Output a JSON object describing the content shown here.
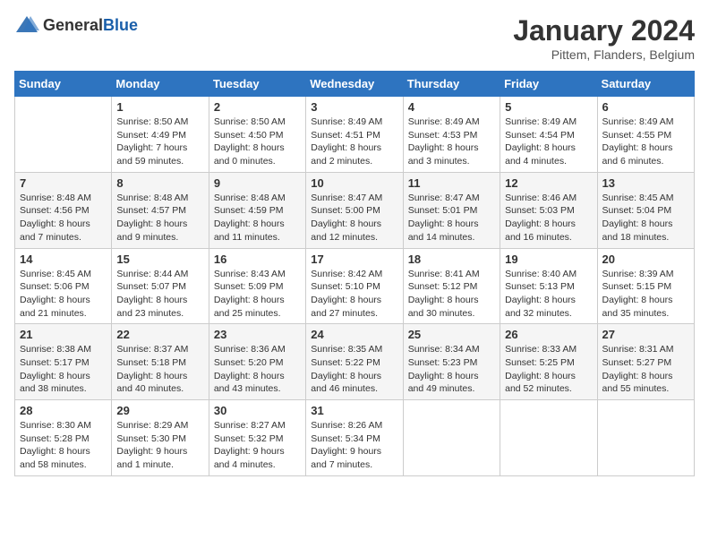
{
  "logo": {
    "general": "General",
    "blue": "Blue"
  },
  "header": {
    "title": "January 2024",
    "subtitle": "Pittem, Flanders, Belgium"
  },
  "days_of_week": [
    "Sunday",
    "Monday",
    "Tuesday",
    "Wednesday",
    "Thursday",
    "Friday",
    "Saturday"
  ],
  "weeks": [
    [
      {
        "day": "",
        "info": ""
      },
      {
        "day": "1",
        "info": "Sunrise: 8:50 AM\nSunset: 4:49 PM\nDaylight: 7 hours and 59 minutes."
      },
      {
        "day": "2",
        "info": "Sunrise: 8:50 AM\nSunset: 4:50 PM\nDaylight: 8 hours and 0 minutes."
      },
      {
        "day": "3",
        "info": "Sunrise: 8:49 AM\nSunset: 4:51 PM\nDaylight: 8 hours and 2 minutes."
      },
      {
        "day": "4",
        "info": "Sunrise: 8:49 AM\nSunset: 4:53 PM\nDaylight: 8 hours and 3 minutes."
      },
      {
        "day": "5",
        "info": "Sunrise: 8:49 AM\nSunset: 4:54 PM\nDaylight: 8 hours and 4 minutes."
      },
      {
        "day": "6",
        "info": "Sunrise: 8:49 AM\nSunset: 4:55 PM\nDaylight: 8 hours and 6 minutes."
      }
    ],
    [
      {
        "day": "7",
        "info": "Sunrise: 8:48 AM\nSunset: 4:56 PM\nDaylight: 8 hours and 7 minutes."
      },
      {
        "day": "8",
        "info": "Sunrise: 8:48 AM\nSunset: 4:57 PM\nDaylight: 8 hours and 9 minutes."
      },
      {
        "day": "9",
        "info": "Sunrise: 8:48 AM\nSunset: 4:59 PM\nDaylight: 8 hours and 11 minutes."
      },
      {
        "day": "10",
        "info": "Sunrise: 8:47 AM\nSunset: 5:00 PM\nDaylight: 8 hours and 12 minutes."
      },
      {
        "day": "11",
        "info": "Sunrise: 8:47 AM\nSunset: 5:01 PM\nDaylight: 8 hours and 14 minutes."
      },
      {
        "day": "12",
        "info": "Sunrise: 8:46 AM\nSunset: 5:03 PM\nDaylight: 8 hours and 16 minutes."
      },
      {
        "day": "13",
        "info": "Sunrise: 8:45 AM\nSunset: 5:04 PM\nDaylight: 8 hours and 18 minutes."
      }
    ],
    [
      {
        "day": "14",
        "info": "Sunrise: 8:45 AM\nSunset: 5:06 PM\nDaylight: 8 hours and 21 minutes."
      },
      {
        "day": "15",
        "info": "Sunrise: 8:44 AM\nSunset: 5:07 PM\nDaylight: 8 hours and 23 minutes."
      },
      {
        "day": "16",
        "info": "Sunrise: 8:43 AM\nSunset: 5:09 PM\nDaylight: 8 hours and 25 minutes."
      },
      {
        "day": "17",
        "info": "Sunrise: 8:42 AM\nSunset: 5:10 PM\nDaylight: 8 hours and 27 minutes."
      },
      {
        "day": "18",
        "info": "Sunrise: 8:41 AM\nSunset: 5:12 PM\nDaylight: 8 hours and 30 minutes."
      },
      {
        "day": "19",
        "info": "Sunrise: 8:40 AM\nSunset: 5:13 PM\nDaylight: 8 hours and 32 minutes."
      },
      {
        "day": "20",
        "info": "Sunrise: 8:39 AM\nSunset: 5:15 PM\nDaylight: 8 hours and 35 minutes."
      }
    ],
    [
      {
        "day": "21",
        "info": "Sunrise: 8:38 AM\nSunset: 5:17 PM\nDaylight: 8 hours and 38 minutes."
      },
      {
        "day": "22",
        "info": "Sunrise: 8:37 AM\nSunset: 5:18 PM\nDaylight: 8 hours and 40 minutes."
      },
      {
        "day": "23",
        "info": "Sunrise: 8:36 AM\nSunset: 5:20 PM\nDaylight: 8 hours and 43 minutes."
      },
      {
        "day": "24",
        "info": "Sunrise: 8:35 AM\nSunset: 5:22 PM\nDaylight: 8 hours and 46 minutes."
      },
      {
        "day": "25",
        "info": "Sunrise: 8:34 AM\nSunset: 5:23 PM\nDaylight: 8 hours and 49 minutes."
      },
      {
        "day": "26",
        "info": "Sunrise: 8:33 AM\nSunset: 5:25 PM\nDaylight: 8 hours and 52 minutes."
      },
      {
        "day": "27",
        "info": "Sunrise: 8:31 AM\nSunset: 5:27 PM\nDaylight: 8 hours and 55 minutes."
      }
    ],
    [
      {
        "day": "28",
        "info": "Sunrise: 8:30 AM\nSunset: 5:28 PM\nDaylight: 8 hours and 58 minutes."
      },
      {
        "day": "29",
        "info": "Sunrise: 8:29 AM\nSunset: 5:30 PM\nDaylight: 9 hours and 1 minute."
      },
      {
        "day": "30",
        "info": "Sunrise: 8:27 AM\nSunset: 5:32 PM\nDaylight: 9 hours and 4 minutes."
      },
      {
        "day": "31",
        "info": "Sunrise: 8:26 AM\nSunset: 5:34 PM\nDaylight: 9 hours and 7 minutes."
      },
      {
        "day": "",
        "info": ""
      },
      {
        "day": "",
        "info": ""
      },
      {
        "day": "",
        "info": ""
      }
    ]
  ]
}
